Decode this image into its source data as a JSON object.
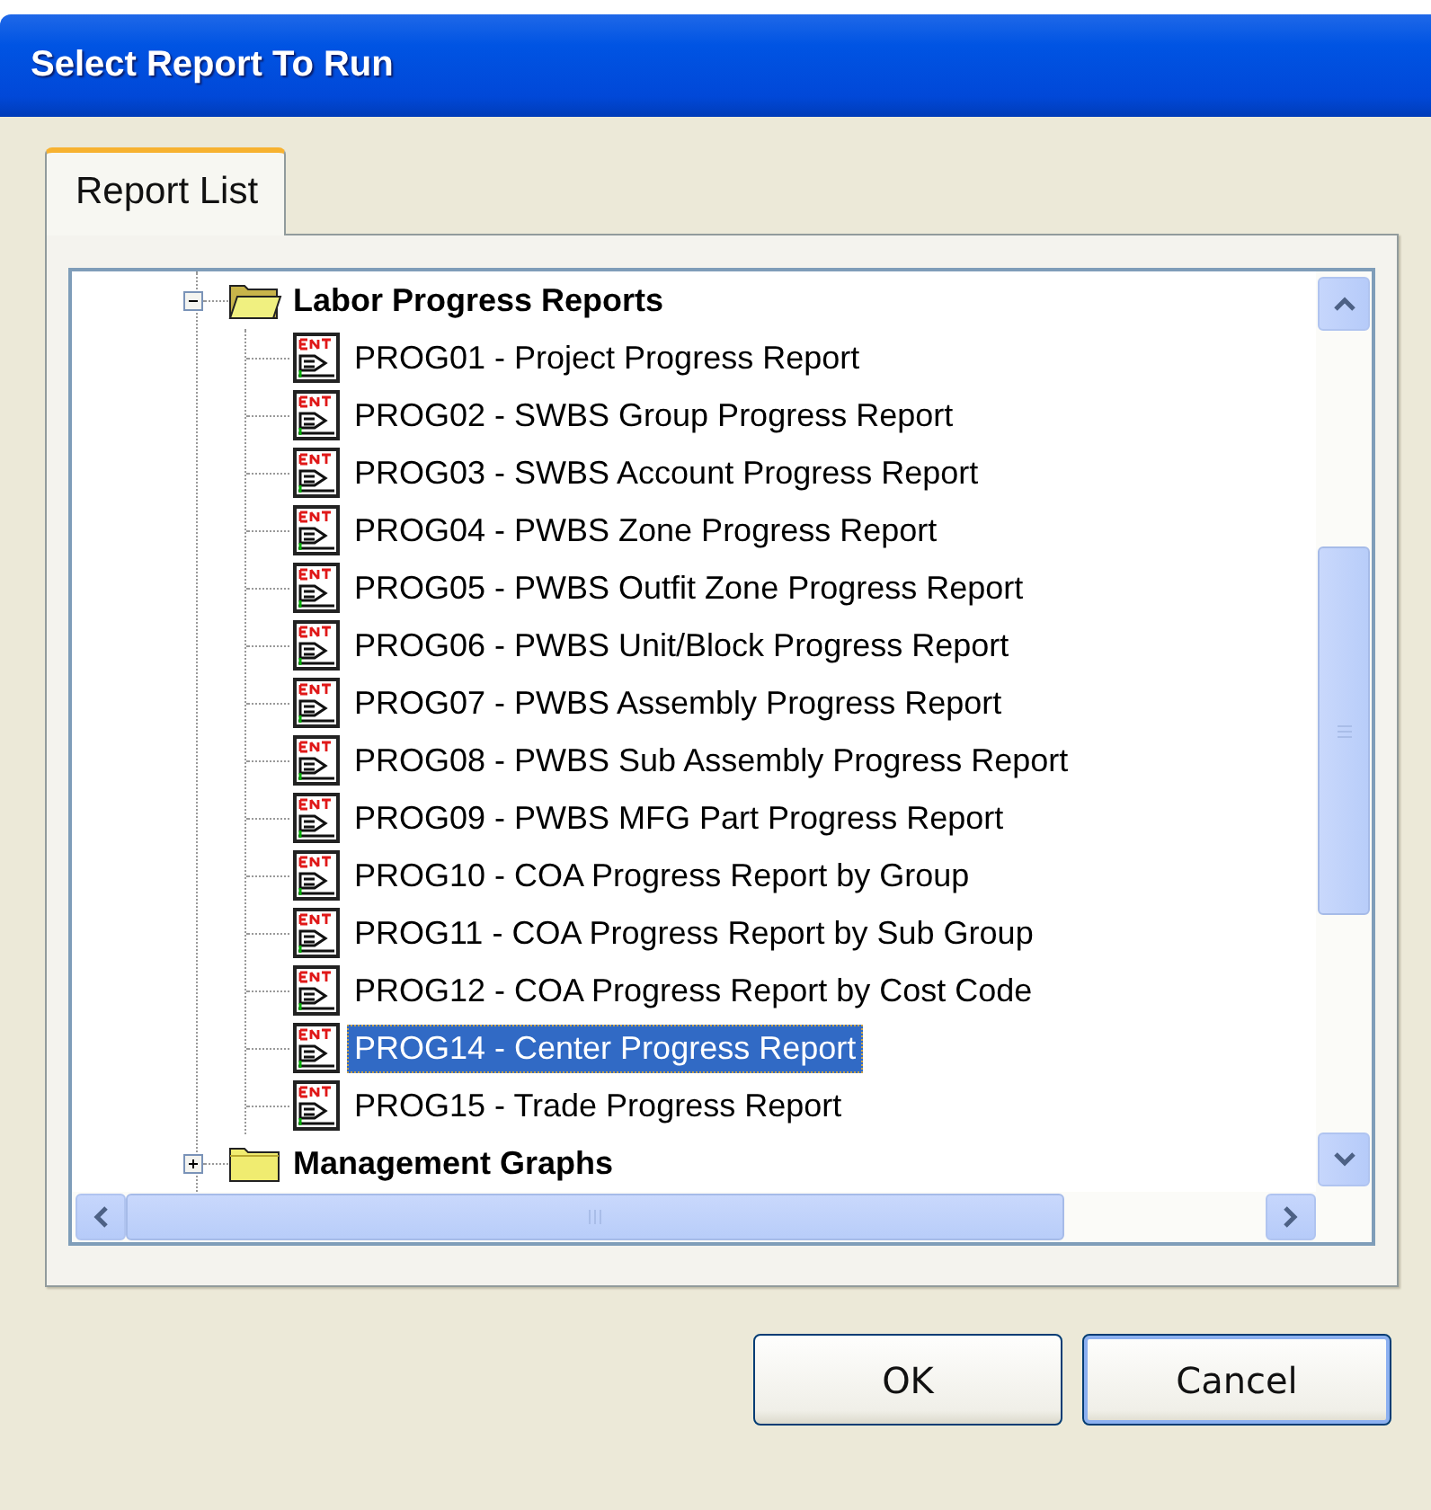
{
  "window": {
    "title": "Select Report To Run"
  },
  "tabs": [
    {
      "label": "Report List",
      "selected": true
    }
  ],
  "tree": [
    {
      "label": "Labor Progress Reports",
      "expanded": true,
      "children": [
        {
          "label": "PROG01 - Project Progress Report",
          "selected": false
        },
        {
          "label": "PROG02 - SWBS Group Progress Report",
          "selected": false
        },
        {
          "label": "PROG03 - SWBS Account Progress Report",
          "selected": false
        },
        {
          "label": "PROG04 - PWBS Zone Progress Report",
          "selected": false
        },
        {
          "label": "PROG05 - PWBS Outfit Zone Progress Report",
          "selected": false
        },
        {
          "label": "PROG06 - PWBS Unit/Block Progress Report",
          "selected": false
        },
        {
          "label": "PROG07 - PWBS Assembly Progress Report",
          "selected": false
        },
        {
          "label": "PROG08 - PWBS Sub Assembly Progress Report",
          "selected": false
        },
        {
          "label": "PROG09 - PWBS MFG Part Progress Report",
          "selected": false
        },
        {
          "label": "PROG10 - COA Progress Report by Group",
          "selected": false
        },
        {
          "label": "PROG11 - COA Progress Report by Sub Group",
          "selected": false
        },
        {
          "label": "PROG12 - COA Progress Report by Cost Code",
          "selected": false
        },
        {
          "label": "PROG14 - Center Progress Report",
          "selected": true
        },
        {
          "label": "PROG15 - Trade Progress Report",
          "selected": false
        }
      ]
    },
    {
      "label": "Management Graphs",
      "expanded": false
    }
  ],
  "buttons": [
    {
      "label": "OK",
      "default": false
    },
    {
      "label": "Cancel",
      "default": true
    }
  ]
}
